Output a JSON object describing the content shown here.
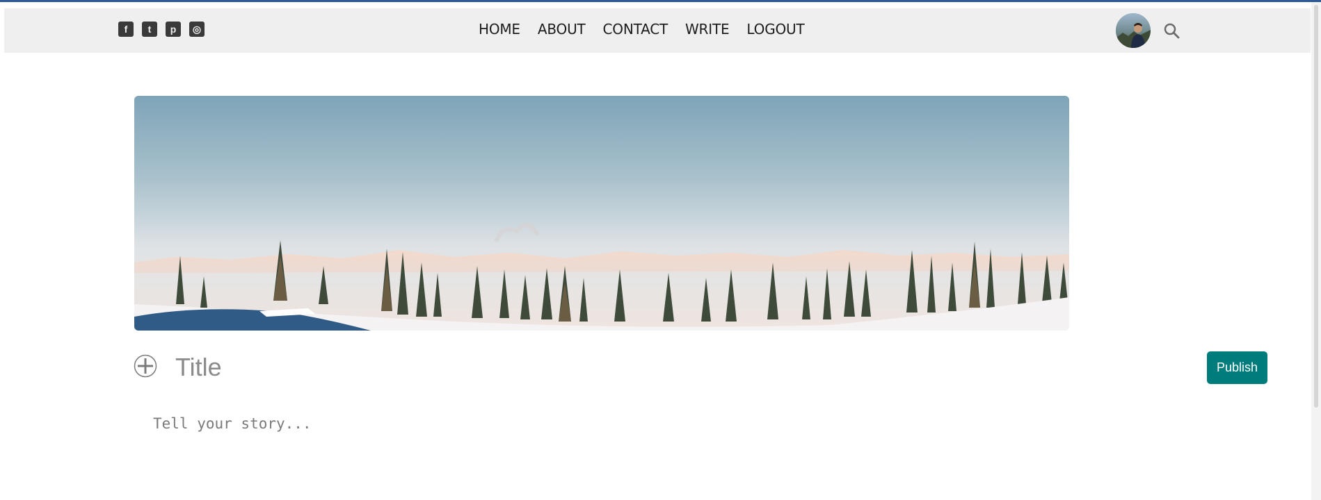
{
  "nav": {
    "social": [
      {
        "name": "facebook-square-icon",
        "glyph": "f"
      },
      {
        "name": "twitter-square-icon",
        "glyph": "t"
      },
      {
        "name": "pinterest-square-icon",
        "glyph": "p"
      },
      {
        "name": "instagram-square-icon",
        "glyph": "◎"
      }
    ],
    "menu": [
      "HOME",
      "ABOUT",
      "CONTACT",
      "WRITE",
      "LOGOUT"
    ],
    "avatar_icon": "profile-avatar",
    "search_icon": "search-icon"
  },
  "banner": {
    "icon": "snowy-forest-mountain-photo"
  },
  "editor": {
    "add_icon": "plus-circle-icon",
    "title_placeholder": "Title",
    "story_placeholder": "Tell your story...",
    "publish_label": "Publish"
  },
  "colors": {
    "accent": "#007c7c",
    "navbar_bg": "#efefef",
    "top_border": "#2e5a9c"
  }
}
